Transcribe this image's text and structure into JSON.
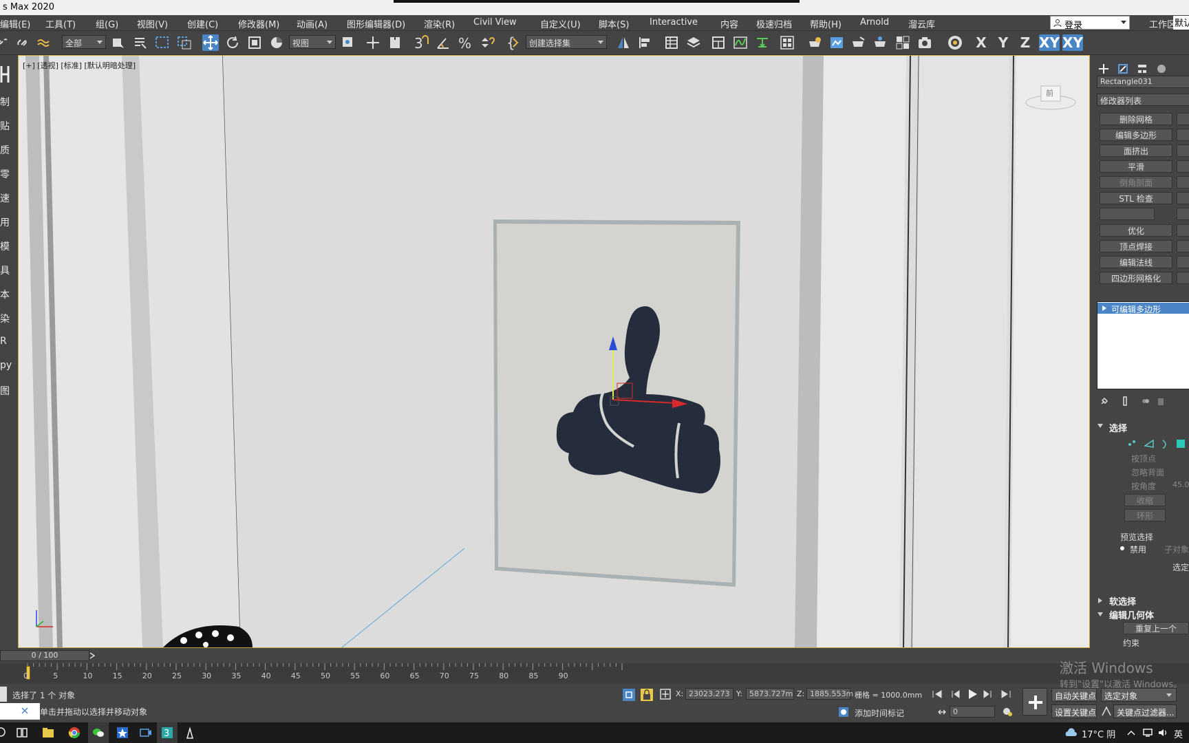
{
  "window": {
    "title": "s Max 2020"
  },
  "menu": [
    "编辑(E)",
    "工具(T)",
    "组(G)",
    "视图(V)",
    "创建(C)",
    "修改器(M)",
    "动画(A)",
    "图形编辑器(D)",
    "渲染(R)",
    "Civil View",
    "自定义(U)",
    "脚本(S)",
    "Interactive",
    "内容",
    "极速归档",
    "帮助(H)",
    "Arnold",
    "溜云库"
  ],
  "login": {
    "label": "登录",
    "workspace_label": "工作区:",
    "workspace_value": "默认"
  },
  "toolbar": {
    "selection_filter": "全部",
    "ref_coord": "视图",
    "named_selection": "创建选择集",
    "axis_x": "X",
    "axis_y": "Y",
    "axis_z": "Z",
    "axis_xy": "XY",
    "axis_xy2": "XY"
  },
  "left_strip": [
    "制",
    "贴",
    "质",
    "零",
    "速",
    "用",
    "模",
    "具",
    "本",
    "染",
    "R",
    "py",
    "图"
  ],
  "viewport": {
    "label": "[+] [透视] [标准] [默认明暗处理]",
    "viewcube_label": "前"
  },
  "right_panel": {
    "object_name": "Rectangle031",
    "modifier_list": "修改器列表",
    "buttons": [
      "删除网格",
      "编辑多边形",
      "面挤出",
      "平滑",
      "倒角剖面",
      "STL 检查",
      "",
      "优化",
      "顶点焊接",
      "编辑法线",
      "四边形网格化"
    ],
    "stack_item": "可编辑多边形",
    "rollout_select": "选择",
    "by_vertex": "按顶点",
    "ignore_backface": "忽略背面",
    "by_angle": "按角度",
    "angle_value": "45.0",
    "shrink": "收缩",
    "ring": "环形",
    "preview_select": "预览选择",
    "disable": "禁用",
    "sub_object": "子对象",
    "selected": "选定",
    "soft_select": "软选择",
    "edit_geometry": "编辑几何体",
    "repeat_last": "重复上一个",
    "constraints": "约束"
  },
  "timeline": {
    "slider": "0 / 100",
    "ticks": [
      "0",
      "5",
      "10",
      "15",
      "20",
      "25",
      "30",
      "35",
      "40",
      "45",
      "50",
      "55",
      "60",
      "65",
      "70",
      "75",
      "80",
      "85",
      "90"
    ]
  },
  "status": {
    "selected_text": "选择了 1 个 对象",
    "hint": "单击并拖动以选择并移动对象",
    "x_label": "X:",
    "x": "23023.273",
    "y_label": "Y:",
    "y": "5873.727m",
    "z_label": "Z:",
    "z": "1885.553m",
    "grid": "栅格 = 1000.0mm",
    "add_time_tag": "添加时间标记",
    "auto_key": "自动关键点",
    "selected_obj": "选定对象",
    "set_key": "设置关键点",
    "key_filter": "关键点过滤器...",
    "frame": "0"
  },
  "watermark": {
    "line1": "激活 Windows",
    "line2": "转到\"设置\"以激活 Windows。"
  },
  "taskbar": {
    "weather": "17°C 阴",
    "lang": "英"
  }
}
